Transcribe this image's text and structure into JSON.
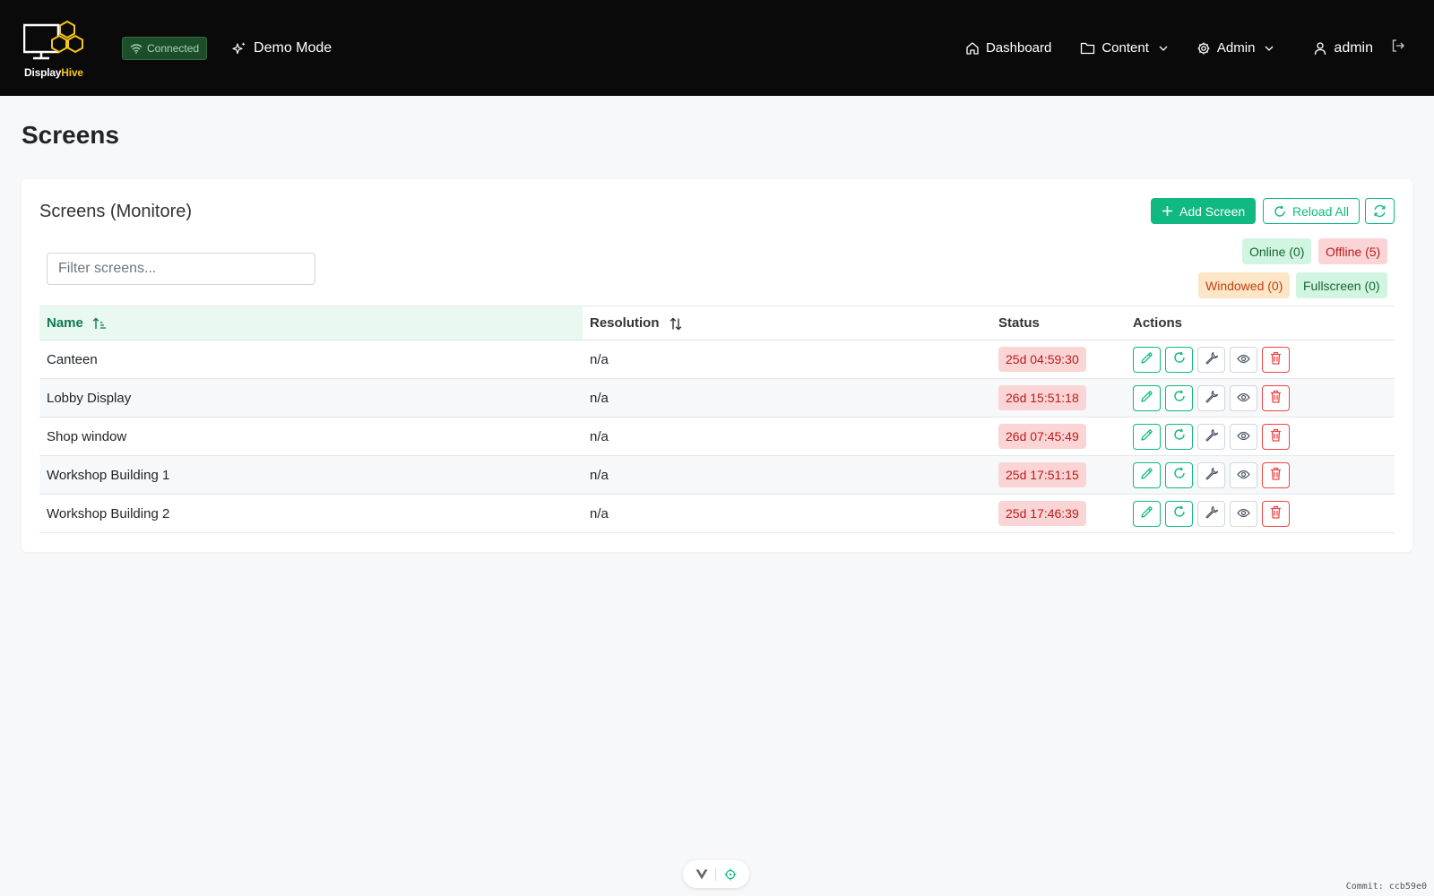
{
  "brand": {
    "name_part1": "Display",
    "name_part2": "Hive"
  },
  "connection": {
    "label": "Connected"
  },
  "demo": {
    "label": "Demo Mode"
  },
  "nav": {
    "dashboard": "Dashboard",
    "content": "Content",
    "admin": "Admin",
    "user": "admin"
  },
  "page": {
    "title": "Screens"
  },
  "card": {
    "title": "Screens (Monitore)",
    "add_label": "Add Screen",
    "reload_label": "Reload All"
  },
  "filter": {
    "placeholder": "Filter screens...",
    "value": ""
  },
  "counts": {
    "online": "Online (0)",
    "offline": "Offline (5)",
    "windowed": "Windowed (0)",
    "fullscreen": "Fullscreen (0)"
  },
  "table": {
    "headers": {
      "name": "Name",
      "resolution": "Resolution",
      "status": "Status",
      "actions": "Actions"
    },
    "rows": [
      {
        "name": "Canteen",
        "resolution": "n/a",
        "status": "25d 04:59:30"
      },
      {
        "name": "Lobby Display",
        "resolution": "n/a",
        "status": "26d 15:51:18"
      },
      {
        "name": "Shop window",
        "resolution": "n/a",
        "status": "26d 07:45:49"
      },
      {
        "name": "Workshop Building 1",
        "resolution": "n/a",
        "status": "25d 17:51:15"
      },
      {
        "name": "Workshop Building 2",
        "resolution": "n/a",
        "status": "25d 17:46:39"
      }
    ]
  },
  "footer": {
    "commit": "Commit: ccb59e0"
  },
  "colors": {
    "accent": "#10b981",
    "danger": "#ef4444",
    "navbar": "#0a0a0a",
    "brand_yellow": "#f5c518"
  }
}
